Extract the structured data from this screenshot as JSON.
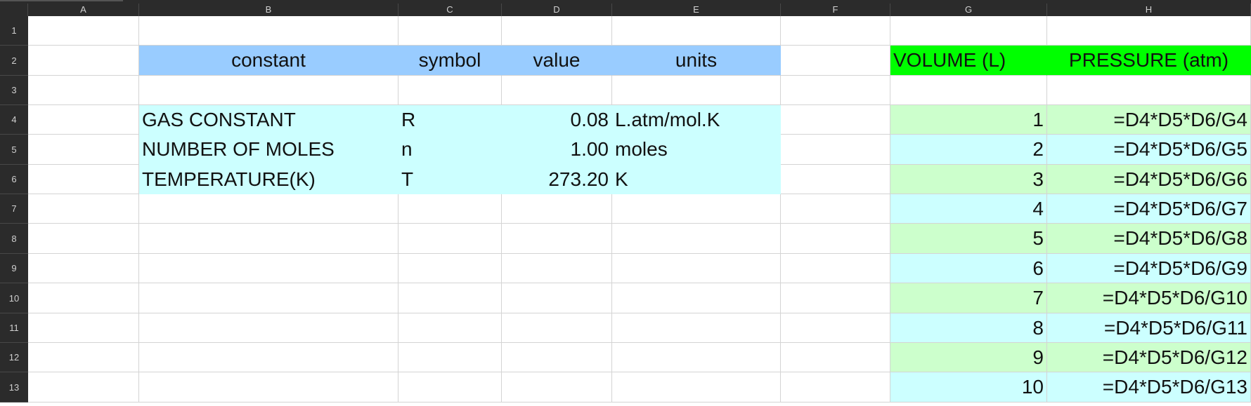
{
  "columns": [
    "A",
    "B",
    "C",
    "D",
    "E",
    "F",
    "G",
    "H"
  ],
  "rows": [
    "1",
    "2",
    "3",
    "4",
    "5",
    "6",
    "7",
    "8",
    "9",
    "10",
    "11",
    "12",
    "13"
  ],
  "colors": {
    "header_fill": "#99ccff",
    "table_fill": "#ccffff",
    "vp_header_fill": "#00ff00",
    "band_green": "#ccffcc",
    "band_cyan": "#ccffff",
    "chrome": "#2b2b2b"
  },
  "constants_table": {
    "headers": {
      "constant": "constant",
      "symbol": "symbol",
      "value": "value",
      "units": "units"
    },
    "rows": [
      {
        "constant": "GAS CONSTANT",
        "symbol": "R",
        "value": "0.08",
        "units": "L.atm/mol.K"
      },
      {
        "constant": "NUMBER OF MOLES",
        "symbol": "n",
        "value": "1.00",
        "units": "moles"
      },
      {
        "constant": "TEMPERATURE(K)",
        "symbol": "T",
        "value": "273.20",
        "units": "K"
      }
    ]
  },
  "pv_table": {
    "headers": {
      "volume": "VOLUME (L)",
      "pressure": "PRESSURE (atm)"
    },
    "rows": [
      {
        "volume": "1",
        "pressure": "=D4*D5*D6/G4"
      },
      {
        "volume": "2",
        "pressure": "=D4*D5*D6/G5"
      },
      {
        "volume": "3",
        "pressure": "=D4*D5*D6/G6"
      },
      {
        "volume": "4",
        "pressure": "=D4*D5*D6/G7"
      },
      {
        "volume": "5",
        "pressure": "=D4*D5*D6/G8"
      },
      {
        "volume": "6",
        "pressure": "=D4*D5*D6/G9"
      },
      {
        "volume": "7",
        "pressure": "=D4*D5*D6/G10"
      },
      {
        "volume": "8",
        "pressure": "=D4*D5*D6/G11"
      },
      {
        "volume": "9",
        "pressure": "=D4*D5*D6/G12"
      },
      {
        "volume": "10",
        "pressure": "=D4*D5*D6/G13"
      }
    ]
  }
}
